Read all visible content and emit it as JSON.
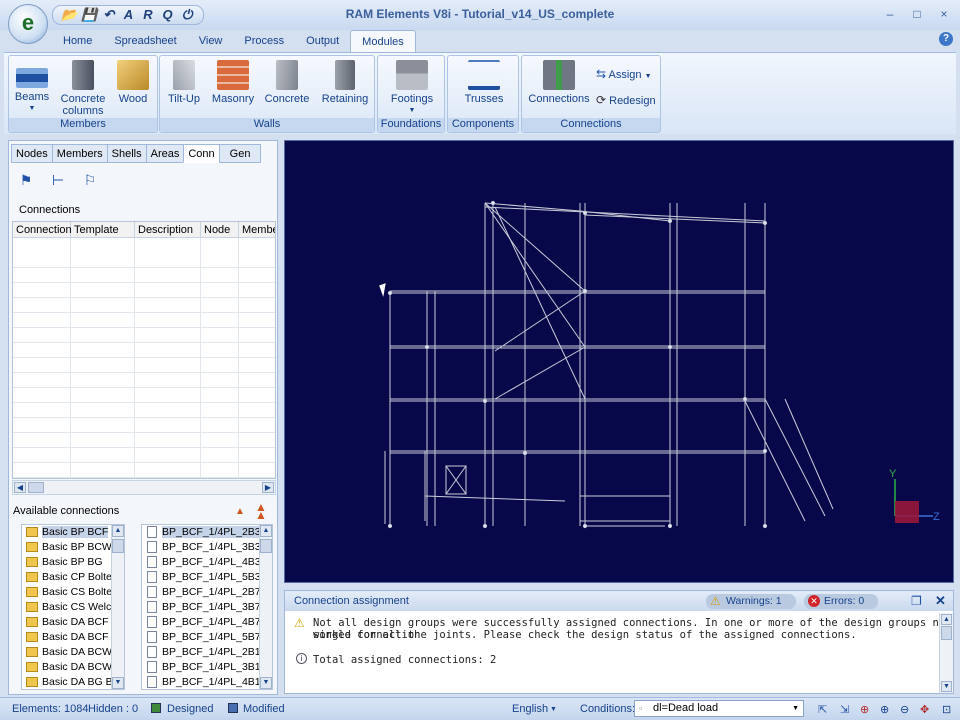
{
  "app": {
    "title": "RAM Elements V8i - Tutorial_v14_US_complete",
    "orb_letter": "e"
  },
  "qat": [
    "open-icon",
    "save-icon",
    "undo-icon",
    "A",
    "R",
    "Q",
    "power-icon"
  ],
  "qat_glyphs": [
    "📂",
    "💾",
    "↶",
    "A",
    "R",
    "Q",
    "⏻"
  ],
  "window_controls": [
    "–",
    "□",
    "×"
  ],
  "tabs": [
    "Home",
    "Spreadsheet",
    "View",
    "Process",
    "Output",
    "Modules"
  ],
  "active_tab": "Modules",
  "ribbon": {
    "members": {
      "label": "Members",
      "buttons": [
        "Beams",
        "Concrete\ncolumns",
        "Wood"
      ]
    },
    "walls": {
      "label": "Walls",
      "buttons": [
        "Tilt-Up",
        "Masonry",
        "Concrete",
        "Retaining"
      ]
    },
    "foundations": {
      "label": "Foundations",
      "buttons": [
        "Footings"
      ]
    },
    "components": {
      "label": "Components",
      "buttons": [
        "Trusses"
      ]
    },
    "connections": {
      "label": "Connections",
      "buttons": [
        "Connections",
        "Assign",
        "Redesign"
      ]
    }
  },
  "panel_tabs": [
    "Nodes",
    "Members",
    "Shells",
    "Areas",
    "Conn",
    "Gen"
  ],
  "active_panel_tab": "Conn",
  "connections_label": "Connections",
  "grid_columns": [
    "Connection",
    "Template",
    "Description",
    "Node",
    "Member"
  ],
  "available_label": "Available connections",
  "available_templates": [
    "Basic BP BCF",
    "Basic BP BCW",
    "Basic BP BG",
    "Basic CP Bolte",
    "Basic CS Bolte",
    "Basic CS Welc",
    "Basic DA BCF",
    "Basic DA BCF",
    "Basic DA BCW",
    "Basic DA BCW",
    "Basic DA BG B"
  ],
  "available_files": [
    "BP_BCF_1/4PL_2B3",
    "BP_BCF_1/4PL_3B3",
    "BP_BCF_1/4PL_4B3,",
    "BP_BCF_1/4PL_5B3,",
    "BP_BCF_1/4PL_2B7,",
    "BP_BCF_1/4PL_3B7,",
    "BP_BCF_1/4PL_4B7,",
    "BP_BCF_1/4PL_5B7,",
    "BP_BCF_1/4PL_2B1",
    "BP_BCF_1/4PL_3B1",
    "BP_BCF_1/4PL_4B1"
  ],
  "message_panel": {
    "title": "Connection assignment",
    "warnings": "Warnings: 1",
    "errors": "Errors: 0",
    "line1": "Not all design groups were successfully assigned connections. In one or more of the design groups no single connection",
    "line2": "worked for all the joints. Please check the design status of the assigned connections.",
    "line3": "Total assigned connections: 2"
  },
  "axes": {
    "y": "Y",
    "z": "Z"
  },
  "status": {
    "elements": "Elements: 1084",
    "hidden": "Hidden : 0",
    "designed": "Designed",
    "modified": "Modified",
    "language": "English",
    "conditions_label": "Conditions:",
    "condition_value": "dl=Dead load"
  },
  "colors": {
    "viewport_bg": "#07084a",
    "ribbon_text": "#15428b",
    "model_lines": "#c8ccd8"
  }
}
